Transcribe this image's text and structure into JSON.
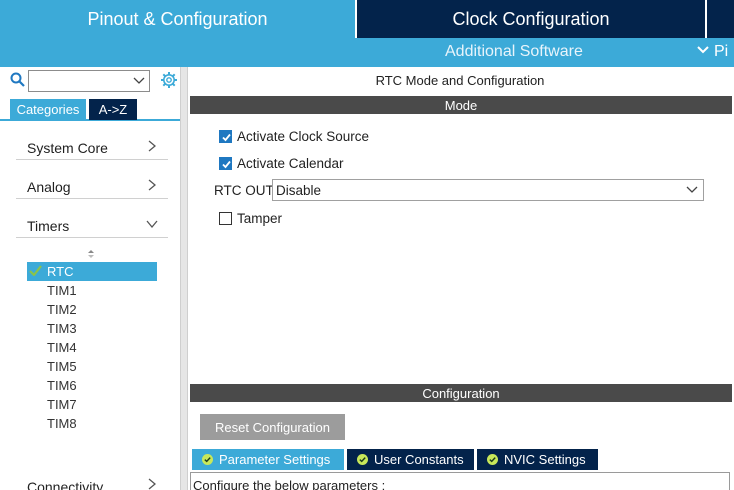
{
  "top_tabs": {
    "pinout": "Pinout & Configuration",
    "clock": "Clock Configuration"
  },
  "subbar": {
    "additional_software": "Additional Software",
    "pinout_label": "Pi"
  },
  "sidebar": {
    "search": {
      "value": ""
    },
    "tabs": {
      "categories": "Categories",
      "az": "A->Z"
    },
    "categories": [
      {
        "label": "System Core",
        "expanded": false
      },
      {
        "label": "Analog",
        "expanded": false
      },
      {
        "label": "Timers",
        "expanded": true
      },
      {
        "label": "Connectivity",
        "expanded": false
      }
    ],
    "timers": [
      "RTC",
      "TIM1",
      "TIM2",
      "TIM3",
      "TIM4",
      "TIM5",
      "TIM6",
      "TIM7",
      "TIM8"
    ],
    "selected_timer": "RTC"
  },
  "main": {
    "title": "RTC Mode and Configuration",
    "mode_header": "Mode",
    "options": {
      "activate_clock_source": {
        "label": "Activate Clock Source",
        "checked": true
      },
      "activate_calendar": {
        "label": "Activate Calendar",
        "checked": true
      },
      "tamper": {
        "label": "Tamper",
        "checked": false
      }
    },
    "rtc_out": {
      "label": "RTC OUT",
      "value": "Disable"
    },
    "config_header": "Configuration",
    "reset_button": "Reset Configuration",
    "config_tabs": [
      "Parameter Settings",
      "User Constants",
      "NVIC Settings"
    ],
    "params_text": "Configure the below parameters :"
  },
  "colors": {
    "accent_blue": "#3caad8",
    "dark_navy": "#03234b",
    "header_gray": "#4a4a4a",
    "checkbox_blue": "#1f78c1",
    "check_green": "#8bc34a"
  }
}
